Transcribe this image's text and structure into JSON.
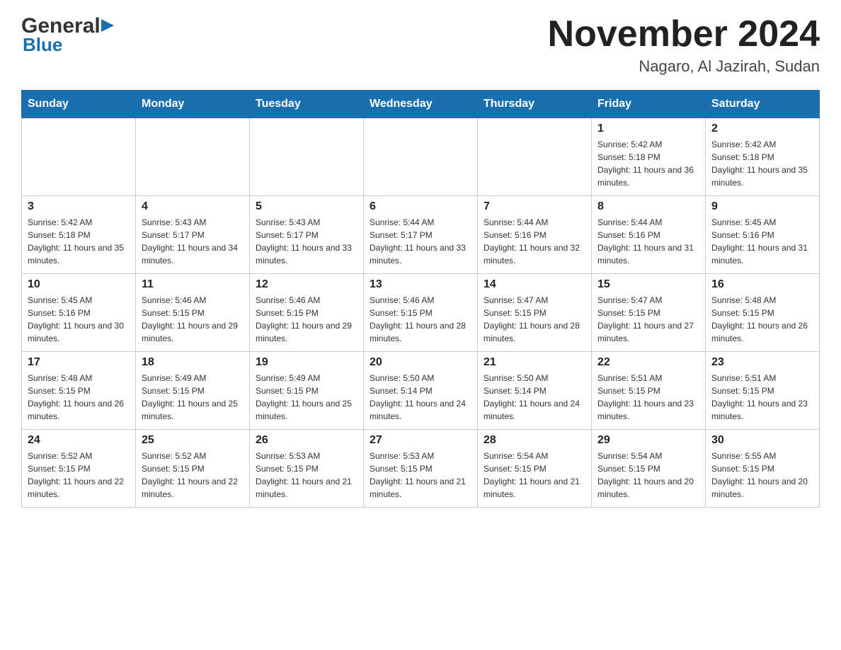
{
  "logo": {
    "general": "General",
    "blue": "Blue",
    "triangle": "▶"
  },
  "header": {
    "month_year": "November 2024",
    "location": "Nagaro, Al Jazirah, Sudan"
  },
  "days_of_week": [
    "Sunday",
    "Monday",
    "Tuesday",
    "Wednesday",
    "Thursday",
    "Friday",
    "Saturday"
  ],
  "weeks": [
    [
      {
        "day": "",
        "info": ""
      },
      {
        "day": "",
        "info": ""
      },
      {
        "day": "",
        "info": ""
      },
      {
        "day": "",
        "info": ""
      },
      {
        "day": "",
        "info": ""
      },
      {
        "day": "1",
        "info": "Sunrise: 5:42 AM\nSunset: 5:18 PM\nDaylight: 11 hours and 36 minutes."
      },
      {
        "day": "2",
        "info": "Sunrise: 5:42 AM\nSunset: 5:18 PM\nDaylight: 11 hours and 35 minutes."
      }
    ],
    [
      {
        "day": "3",
        "info": "Sunrise: 5:42 AM\nSunset: 5:18 PM\nDaylight: 11 hours and 35 minutes."
      },
      {
        "day": "4",
        "info": "Sunrise: 5:43 AM\nSunset: 5:17 PM\nDaylight: 11 hours and 34 minutes."
      },
      {
        "day": "5",
        "info": "Sunrise: 5:43 AM\nSunset: 5:17 PM\nDaylight: 11 hours and 33 minutes."
      },
      {
        "day": "6",
        "info": "Sunrise: 5:44 AM\nSunset: 5:17 PM\nDaylight: 11 hours and 33 minutes."
      },
      {
        "day": "7",
        "info": "Sunrise: 5:44 AM\nSunset: 5:16 PM\nDaylight: 11 hours and 32 minutes."
      },
      {
        "day": "8",
        "info": "Sunrise: 5:44 AM\nSunset: 5:16 PM\nDaylight: 11 hours and 31 minutes."
      },
      {
        "day": "9",
        "info": "Sunrise: 5:45 AM\nSunset: 5:16 PM\nDaylight: 11 hours and 31 minutes."
      }
    ],
    [
      {
        "day": "10",
        "info": "Sunrise: 5:45 AM\nSunset: 5:16 PM\nDaylight: 11 hours and 30 minutes."
      },
      {
        "day": "11",
        "info": "Sunrise: 5:46 AM\nSunset: 5:15 PM\nDaylight: 11 hours and 29 minutes."
      },
      {
        "day": "12",
        "info": "Sunrise: 5:46 AM\nSunset: 5:15 PM\nDaylight: 11 hours and 29 minutes."
      },
      {
        "day": "13",
        "info": "Sunrise: 5:46 AM\nSunset: 5:15 PM\nDaylight: 11 hours and 28 minutes."
      },
      {
        "day": "14",
        "info": "Sunrise: 5:47 AM\nSunset: 5:15 PM\nDaylight: 11 hours and 28 minutes."
      },
      {
        "day": "15",
        "info": "Sunrise: 5:47 AM\nSunset: 5:15 PM\nDaylight: 11 hours and 27 minutes."
      },
      {
        "day": "16",
        "info": "Sunrise: 5:48 AM\nSunset: 5:15 PM\nDaylight: 11 hours and 26 minutes."
      }
    ],
    [
      {
        "day": "17",
        "info": "Sunrise: 5:48 AM\nSunset: 5:15 PM\nDaylight: 11 hours and 26 minutes."
      },
      {
        "day": "18",
        "info": "Sunrise: 5:49 AM\nSunset: 5:15 PM\nDaylight: 11 hours and 25 minutes."
      },
      {
        "day": "19",
        "info": "Sunrise: 5:49 AM\nSunset: 5:15 PM\nDaylight: 11 hours and 25 minutes."
      },
      {
        "day": "20",
        "info": "Sunrise: 5:50 AM\nSunset: 5:14 PM\nDaylight: 11 hours and 24 minutes."
      },
      {
        "day": "21",
        "info": "Sunrise: 5:50 AM\nSunset: 5:14 PM\nDaylight: 11 hours and 24 minutes."
      },
      {
        "day": "22",
        "info": "Sunrise: 5:51 AM\nSunset: 5:15 PM\nDaylight: 11 hours and 23 minutes."
      },
      {
        "day": "23",
        "info": "Sunrise: 5:51 AM\nSunset: 5:15 PM\nDaylight: 11 hours and 23 minutes."
      }
    ],
    [
      {
        "day": "24",
        "info": "Sunrise: 5:52 AM\nSunset: 5:15 PM\nDaylight: 11 hours and 22 minutes."
      },
      {
        "day": "25",
        "info": "Sunrise: 5:52 AM\nSunset: 5:15 PM\nDaylight: 11 hours and 22 minutes."
      },
      {
        "day": "26",
        "info": "Sunrise: 5:53 AM\nSunset: 5:15 PM\nDaylight: 11 hours and 21 minutes."
      },
      {
        "day": "27",
        "info": "Sunrise: 5:53 AM\nSunset: 5:15 PM\nDaylight: 11 hours and 21 minutes."
      },
      {
        "day": "28",
        "info": "Sunrise: 5:54 AM\nSunset: 5:15 PM\nDaylight: 11 hours and 21 minutes."
      },
      {
        "day": "29",
        "info": "Sunrise: 5:54 AM\nSunset: 5:15 PM\nDaylight: 11 hours and 20 minutes."
      },
      {
        "day": "30",
        "info": "Sunrise: 5:55 AM\nSunset: 5:15 PM\nDaylight: 11 hours and 20 minutes."
      }
    ]
  ]
}
